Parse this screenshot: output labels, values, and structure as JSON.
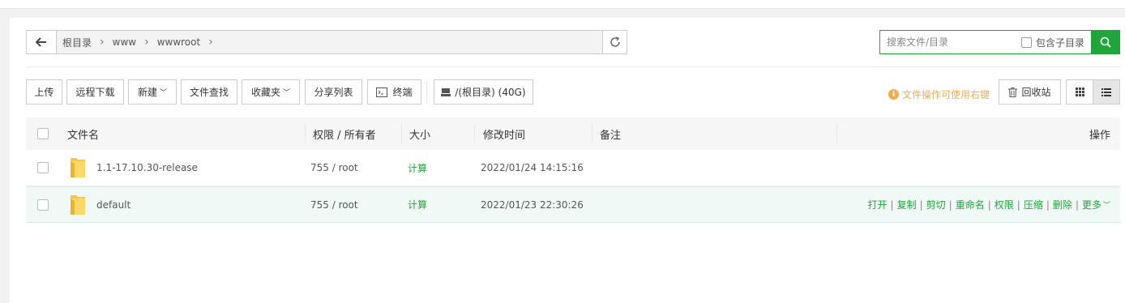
{
  "path": {
    "crumbs": [
      "根目录",
      "www",
      "wwwroot"
    ]
  },
  "search": {
    "placeholder": "搜索文件/目录",
    "include_subdir_label": "包含子目录"
  },
  "toolbar": {
    "upload": "上传",
    "remote_download": "远程下载",
    "new": "新建",
    "file_search": "文件查找",
    "favorites": "收藏夹",
    "share_list": "分享列表",
    "terminal": "终端",
    "disk": "/(根目录) (40G)",
    "hint": "文件操作可使用右键",
    "recycle_bin": "回收站"
  },
  "table": {
    "headers": {
      "name": "文件名",
      "perm": "权限 / 所有者",
      "size": "大小",
      "mtime": "修改时间",
      "note": "备注",
      "ops": "操作"
    },
    "rows": [
      {
        "name": "1.1-17.10.30-release",
        "perm": "755 / root",
        "size": "计算",
        "mtime": "2022/01/24 14:15:16",
        "note": ""
      },
      {
        "name": "default",
        "perm": "755 / root",
        "size": "计算",
        "mtime": "2022/01/23 22:30:26",
        "note": ""
      }
    ],
    "row_ops": [
      "打开",
      "复制",
      "剪切",
      "重命名",
      "权限",
      "压缩",
      "删除",
      "更多"
    ]
  },
  "colors": {
    "accent": "#20a53a",
    "hint": "#f0ad4e",
    "folder": "#f5c742"
  }
}
